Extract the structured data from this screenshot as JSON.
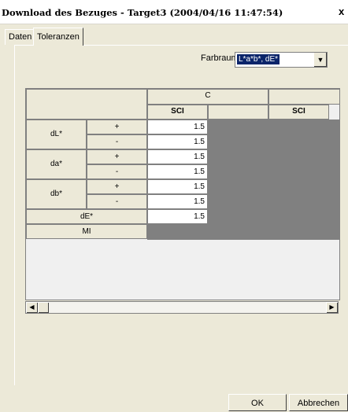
{
  "window": {
    "title": "Download des Bezuges - Target3 (2004/04/16 11:47:54)",
    "close_glyph": "x"
  },
  "tabs": [
    {
      "label": "Daten",
      "active": false
    },
    {
      "label": "Toleranzen",
      "active": true
    }
  ],
  "farbraum": {
    "label": "Farbraum",
    "value": "L*a*b*, dE*"
  },
  "table": {
    "column_groups": [
      "C",
      ""
    ],
    "sub_headers": [
      "SCI",
      "",
      "SCI"
    ],
    "rows": [
      {
        "group": "dL*",
        "sign": "+",
        "value": "1.5"
      },
      {
        "group": "dL*",
        "sign": "-",
        "value": "1.5"
      },
      {
        "group": "da*",
        "sign": "+",
        "value": "1.5"
      },
      {
        "group": "da*",
        "sign": "-",
        "value": "1.5"
      },
      {
        "group": "db*",
        "sign": "+",
        "value": "1.5"
      },
      {
        "group": "db*",
        "sign": "-",
        "value": "1.5"
      },
      {
        "group": "dE*",
        "sign": "",
        "value": "1.5"
      },
      {
        "group": "MI",
        "sign": "",
        "value": ""
      }
    ],
    "row_groups": [
      "dL*",
      "da*",
      "db*"
    ],
    "single_rows": [
      "dE*",
      "MI"
    ]
  },
  "buttons": {
    "ok": "OK",
    "cancel": "Abbrechen"
  }
}
